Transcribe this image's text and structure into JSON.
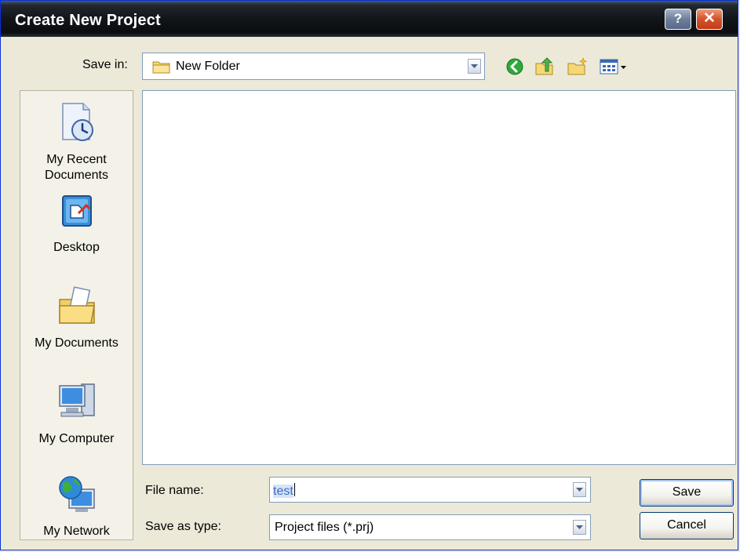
{
  "window": {
    "title": "Create New Project",
    "help_label": "?",
    "close_label": "✕"
  },
  "savein": {
    "label": "Save in:",
    "value": "New Folder"
  },
  "toolbar": {
    "back_icon": "back-arrow-icon",
    "up_icon": "up-folder-icon",
    "newfolder_icon": "new-folder-icon",
    "views_icon": "views-menu-icon"
  },
  "places": [
    {
      "label_line1": "My Recent",
      "label_line2": "Documents",
      "icon": "recent-documents-icon"
    },
    {
      "label_line1": "Desktop",
      "label_line2": "",
      "icon": "desktop-icon"
    },
    {
      "label_line1": "My Documents",
      "label_line2": "",
      "icon": "my-documents-icon"
    },
    {
      "label_line1": "My Computer",
      "label_line2": "",
      "icon": "my-computer-icon"
    },
    {
      "label_line1": "My Network",
      "label_line2": "",
      "icon": "my-network-icon"
    }
  ],
  "filename": {
    "label": "File name:",
    "value": "test"
  },
  "filetype": {
    "label": "Save as type:",
    "value": "Project files (*.prj)"
  },
  "buttons": {
    "save": "Save",
    "cancel": "Cancel"
  },
  "colors": {
    "accent": "#0831d9",
    "title_bar": "#11151a",
    "dialog_bg": "#ece9d8"
  }
}
